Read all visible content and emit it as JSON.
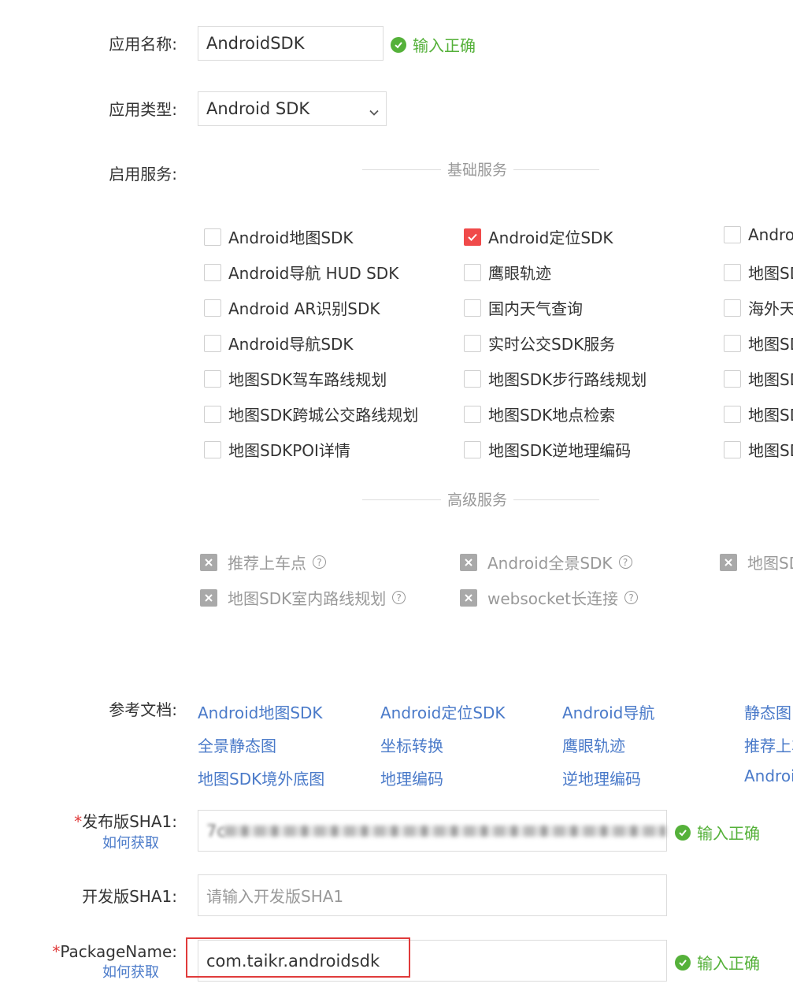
{
  "app_name": {
    "label": "应用名称:",
    "value": "AndroidSDK",
    "status": "输入正确"
  },
  "app_type": {
    "label": "应用类型:",
    "selected": "Android SDK"
  },
  "services": {
    "label": "启用服务:",
    "basic_title": "基础服务",
    "col1": [
      "Android地图SDK",
      "Android导航 HUD SDK",
      "Android AR识别SDK",
      "Android导航SDK",
      "地图SDK驾车路线规划",
      "地图SDK跨城公交路线规划",
      "地图SDKPOI详情"
    ],
    "col2": [
      "Android定位SDK",
      "鹰眼轨迹",
      "国内天气查询",
      "实时公交SDK服务",
      "地图SDK步行路线规划",
      "地图SDK地点检索",
      "地图SDK逆地理编码"
    ],
    "col2_checked": [
      true,
      false,
      false,
      false,
      false,
      false,
      false
    ],
    "col3": [
      "Andro",
      "地图SD",
      "海外天",
      "地图SD",
      "地图SD",
      "地图SD",
      "地图SD"
    ],
    "advanced_title": "高级服务",
    "advanced": [
      "推荐上车点",
      "Android全景SDK",
      "地图SD",
      "地图SDK室内路线规划",
      "websocket长连接"
    ]
  },
  "docs": {
    "label": "参考文档:",
    "row1": [
      "Android地图SDK",
      "Android定位SDK",
      "Android导航",
      "静态图"
    ],
    "row2": [
      "全景静态图",
      "坐标转换",
      "鹰眼轨迹",
      "推荐上车"
    ],
    "row3": [
      "地图SDK境外底图",
      "地理编码",
      "逆地理编码",
      "Androi"
    ]
  },
  "release_sha1": {
    "required": "*",
    "label": "发布版SHA1:",
    "howto": "如何获取",
    "value_prefix": "7c",
    "status": "输入正确"
  },
  "dev_sha1": {
    "label": "开发版SHA1:",
    "placeholder": "请输入开发版SHA1"
  },
  "package_name": {
    "required": "*",
    "label": "PackageName:",
    "howto": "如何获取",
    "value": "com.taikr.androidsdk",
    "status": "输入正确"
  },
  "colors": {
    "accent_green": "#55b13a",
    "link_blue": "#4a7ac9",
    "checkbox_red": "#f04a4a",
    "highlight_red": "#e03b3b"
  }
}
